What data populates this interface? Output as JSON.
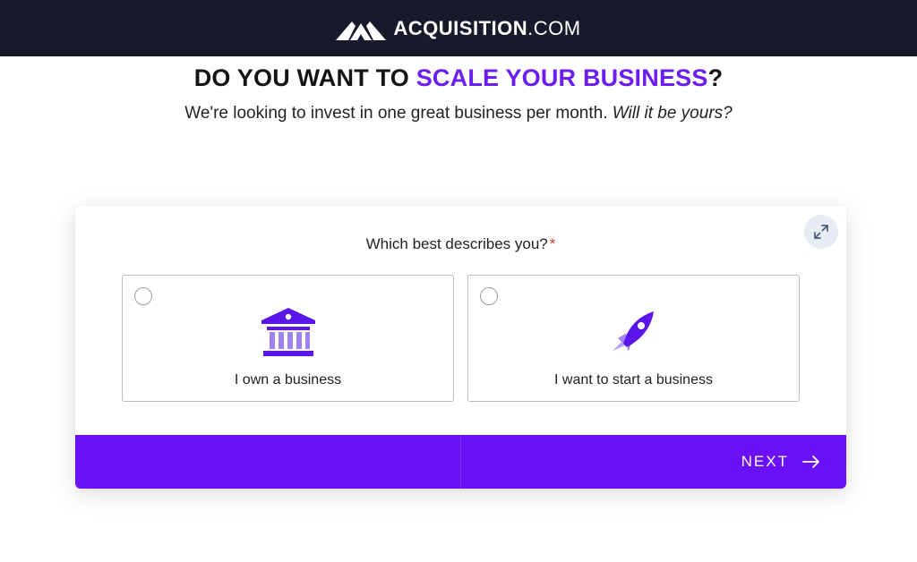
{
  "header": {
    "brand_strong": "ACQUISITION",
    "brand_light": ".COM",
    "logo_icon": "mountain-logo-icon",
    "background": "#181a2b"
  },
  "hero": {
    "title_prefix": "DO YOU WANT TO ",
    "title_accent": "SCALE YOUR BUSINESS",
    "title_suffix": "?",
    "subtitle": "We're looking to invest in one great business per month.",
    "subtitle_em": "Will it be yours?",
    "accent_color": "#6c1df0"
  },
  "form": {
    "question": "Which best describes you?",
    "required_mark": "*",
    "expand_icon": "expand-arrows-icon",
    "options": [
      {
        "label": "I own a business",
        "icon": "bank-building-icon",
        "selected": false
      },
      {
        "label": "I want to start a business",
        "icon": "rocket-icon",
        "selected": false
      }
    ],
    "next_label": "NEXT",
    "next_icon": "arrow-right-icon",
    "footer_color": "#6a10f7"
  }
}
